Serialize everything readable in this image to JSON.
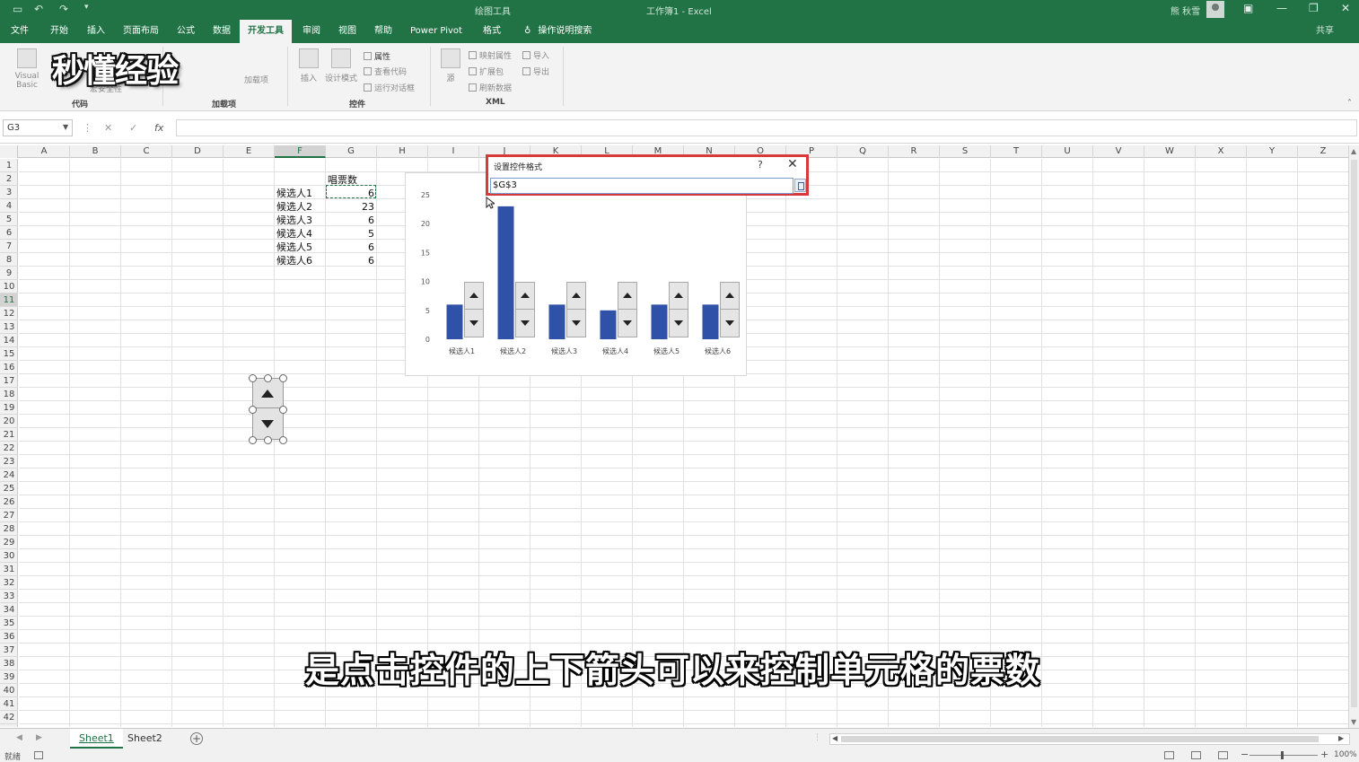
{
  "titlebar": {
    "context_tool": "绘图工具",
    "doc_title": "工作簿1 - Excel",
    "user_name": "熊 秋雪"
  },
  "tabs": [
    "文件",
    "开始",
    "插入",
    "页面布局",
    "公式",
    "数据",
    "开发工具",
    "审阅",
    "视图",
    "帮助",
    "Power Pivot",
    "格式"
  ],
  "active_tab": "开发工具",
  "search_hint": "操作说明搜索",
  "share_label": "共享",
  "ribbon": {
    "watermark": "秒懂经验",
    "groups": {
      "code": "代码",
      "addins": "加载项",
      "controls": "控件",
      "xml": "XML"
    },
    "buttons": {
      "visual_basic": "Visual Basic",
      "macro_security": "宏安全性",
      "addins": "加载项",
      "insert": "插入",
      "design_mode": "设计模式",
      "properties": "属性",
      "view_code": "查看代码",
      "run_dialog": "运行对话框",
      "source": "源",
      "map_properties": "映射属性",
      "expansion_packs": "扩展包",
      "refresh_data": "刷新数据",
      "import": "导入",
      "export": "导出"
    }
  },
  "formula_bar": {
    "name_box": "G3",
    "cancel_icon": "✕",
    "enter_icon": "✓",
    "fx_icon": "fx",
    "value": ""
  },
  "columns": [
    "A",
    "B",
    "C",
    "D",
    "E",
    "F",
    "G",
    "H",
    "I",
    "J",
    "K",
    "L",
    "M",
    "N",
    "O",
    "P",
    "Q",
    "R",
    "S",
    "T",
    "U",
    "V",
    "W",
    "X",
    "Y",
    "Z"
  ],
  "selected_column": "F",
  "rows": [
    "1",
    "2",
    "3",
    "4",
    "5",
    "6",
    "7",
    "8",
    "9",
    "10",
    "11",
    "12",
    "13",
    "14",
    "15",
    "16",
    "17",
    "18",
    "19",
    "20",
    "21",
    "22",
    "23",
    "24",
    "25",
    "26",
    "27",
    "28",
    "29",
    "30",
    "31",
    "32",
    "33",
    "34",
    "35",
    "36",
    "37",
    "38",
    "39",
    "40",
    "41",
    "42"
  ],
  "selected_row": "11",
  "table": {
    "header": "唱票数",
    "candidates": [
      {
        "name": "候选人1",
        "votes": "6"
      },
      {
        "name": "候选人2",
        "votes": "23"
      },
      {
        "name": "候选人3",
        "votes": "6"
      },
      {
        "name": "候选人4",
        "votes": "5"
      },
      {
        "name": "候选人5",
        "votes": "6"
      },
      {
        "name": "候选人6",
        "votes": "6"
      }
    ]
  },
  "chart_data": {
    "type": "bar",
    "categories": [
      "候选人1",
      "候选人2",
      "候选人3",
      "候选人4",
      "候选人5",
      "候选人6"
    ],
    "values": [
      6,
      23,
      6,
      5,
      6,
      6
    ],
    "ylim": [
      0,
      25
    ],
    "yticks": [
      "0",
      "5",
      "10",
      "15",
      "20",
      "25"
    ],
    "bar_color": "#2f52a8",
    "grid": false,
    "legend": "none"
  },
  "dialog": {
    "title": "设置控件格式",
    "help": "?",
    "close": "✕",
    "value": "$G$3"
  },
  "subtitle": "是点击控件的上下箭头可以来控制单元格的票数",
  "sheets": [
    "Sheet1",
    "Sheet2"
  ],
  "active_sheet": "Sheet1",
  "status": {
    "ready": "就绪",
    "zoom": "100%"
  },
  "colors": {
    "excel_green": "#217346",
    "dialog_border": "#d63a3a"
  }
}
